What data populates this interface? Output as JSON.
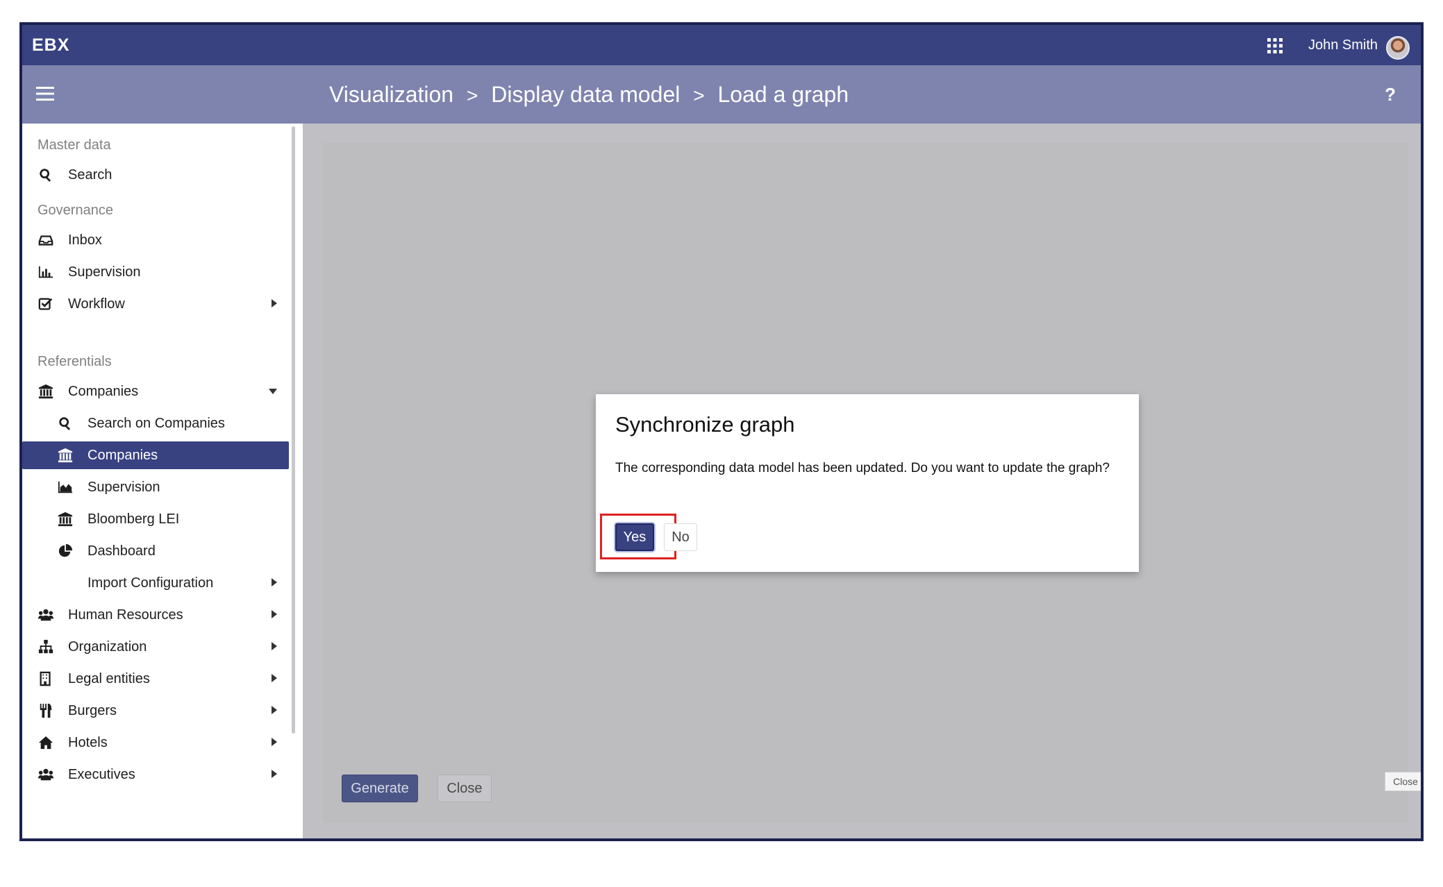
{
  "app": {
    "brand": "EBX",
    "user_name": "John Smith"
  },
  "header": {
    "breadcrumb": [
      "Visualization",
      "Display data model",
      "Load a graph"
    ],
    "separator": ">",
    "help": "?"
  },
  "sidebar": {
    "sections": {
      "master_data": "Master data",
      "governance": "Governance",
      "referentials": "Referentials"
    },
    "items": {
      "search": "Search",
      "inbox": "Inbox",
      "supervision": "Supervision",
      "workflow": "Workflow",
      "companies": "Companies",
      "search_on_companies": "Search on Companies",
      "companies_table": "Companies",
      "companies_supervision": "Supervision",
      "bloomberg_lei": "Bloomberg LEI",
      "dashboard": "Dashboard",
      "import_configuration": "Import Configuration",
      "human_resources": "Human Resources",
      "organization": "Organization",
      "legal_entities": "Legal entities",
      "burgers": "Burgers",
      "hotels": "Hotels",
      "executives": "Executives"
    },
    "active_item": "companies_table"
  },
  "main": {
    "generate_label": "Generate",
    "close_label": "Close",
    "corner_close_label": "Close"
  },
  "dialog": {
    "title": "Synchronize graph",
    "message": "The corresponding data model has been updated. Do you want to update the graph?",
    "yes_label": "Yes",
    "no_label": "No"
  },
  "colors": {
    "topbar": "#384281",
    "header": "#7e84ae",
    "active_item": "#384281",
    "highlight": "#e02020",
    "overlay": "#c0bfc3"
  }
}
